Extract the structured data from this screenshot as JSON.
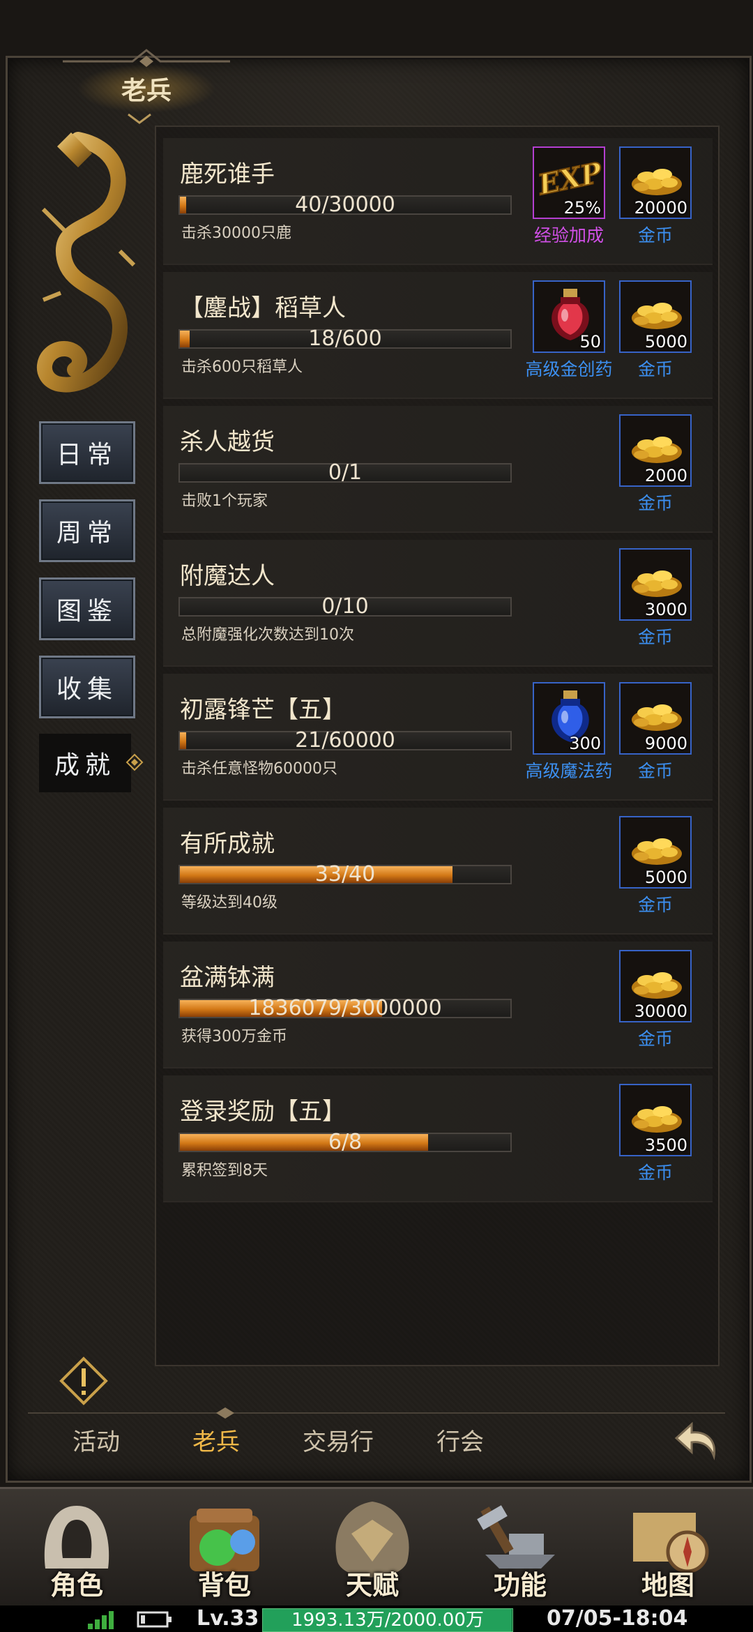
{
  "header": {
    "title": "老兵"
  },
  "sidebar": {
    "items": [
      {
        "label": "日常",
        "active": false
      },
      {
        "label": "周常",
        "active": false
      },
      {
        "label": "图鉴",
        "active": false
      },
      {
        "label": "收集",
        "active": false
      },
      {
        "label": "成就",
        "active": true
      }
    ]
  },
  "achievements": [
    {
      "name": "鹿死谁手",
      "progress_text": "40/30000",
      "progress": 0.0013,
      "desc": "击杀30000只鹿",
      "rewards": [
        {
          "icon": "exp-bonus-icon",
          "qty": "25%",
          "label": "经验加成",
          "color": "purple"
        },
        {
          "icon": "gold-coins-icon",
          "qty": "20000",
          "label": "金币",
          "color": "blue"
        }
      ]
    },
    {
      "name": "【鏖战】稻草人",
      "progress_text": "18/600",
      "progress": 0.03,
      "desc": "击杀600只稻草人",
      "rewards": [
        {
          "icon": "red-potion-icon",
          "qty": "50",
          "label": "高级金创药",
          "color": "blue"
        },
        {
          "icon": "gold-coins-icon",
          "qty": "5000",
          "label": "金币",
          "color": "blue"
        }
      ]
    },
    {
      "name": "杀人越货",
      "progress_text": "0/1",
      "progress": 0,
      "desc": "击败1个玩家",
      "rewards": [
        {
          "icon": "gold-coins-icon",
          "qty": "2000",
          "label": "金币",
          "color": "blue"
        }
      ]
    },
    {
      "name": "附魔达人",
      "progress_text": "0/10",
      "progress": 0,
      "desc": "总附魔强化次数达到10次",
      "rewards": [
        {
          "icon": "gold-coins-icon",
          "qty": "3000",
          "label": "金币",
          "color": "blue"
        }
      ]
    },
    {
      "name": "初露锋芒【五】",
      "progress_text": "21/60000",
      "progress": 0.0004,
      "desc": "击杀任意怪物60000只",
      "rewards": [
        {
          "icon": "blue-potion-icon",
          "qty": "300",
          "label": "高级魔法药",
          "color": "blue"
        },
        {
          "icon": "gold-coins-icon",
          "qty": "9000",
          "label": "金币",
          "color": "blue"
        }
      ]
    },
    {
      "name": "有所成就",
      "progress_text": "33/40",
      "progress": 0.825,
      "desc": "等级达到40级",
      "rewards": [
        {
          "icon": "gold-coins-icon",
          "qty": "5000",
          "label": "金币",
          "color": "blue"
        }
      ]
    },
    {
      "name": "盆满钵满",
      "progress_text": "1836079/3000000",
      "progress": 0.612,
      "desc": "获得300万金币",
      "rewards": [
        {
          "icon": "gold-coins-icon",
          "qty": "30000",
          "label": "金币",
          "color": "blue"
        }
      ]
    },
    {
      "name": "登录奖励【五】",
      "progress_text": "6/8",
      "progress": 0.75,
      "desc": "累积签到8天",
      "rewards": [
        {
          "icon": "gold-coins-icon",
          "qty": "3500",
          "label": "金币",
          "color": "blue"
        }
      ]
    }
  ],
  "bottom_tabs": [
    {
      "label": "活动",
      "active": false
    },
    {
      "label": "老兵",
      "active": true
    },
    {
      "label": "交易行",
      "active": false
    },
    {
      "label": "行会",
      "active": false
    }
  ],
  "bottom_nav": [
    {
      "label": "角色",
      "icon": "hooded-character-icon"
    },
    {
      "label": "背包",
      "icon": "backpack-potion-icon"
    },
    {
      "label": "天赋",
      "icon": "dragon-emblem-icon"
    },
    {
      "label": "功能",
      "icon": "anvil-hammer-icon"
    },
    {
      "label": "地图",
      "icon": "map-compass-icon"
    }
  ],
  "status": {
    "level": "Lv.33",
    "exp_text": "1993.13万/2000.00万",
    "exp_fraction": 0.9966,
    "datetime": "07/05-18:04"
  },
  "colors": {
    "accent_gold": "#f0b848",
    "reward_blue": "#3c8ff0",
    "reward_purple": "#d04fe6",
    "progress_orange": "#d27816"
  }
}
